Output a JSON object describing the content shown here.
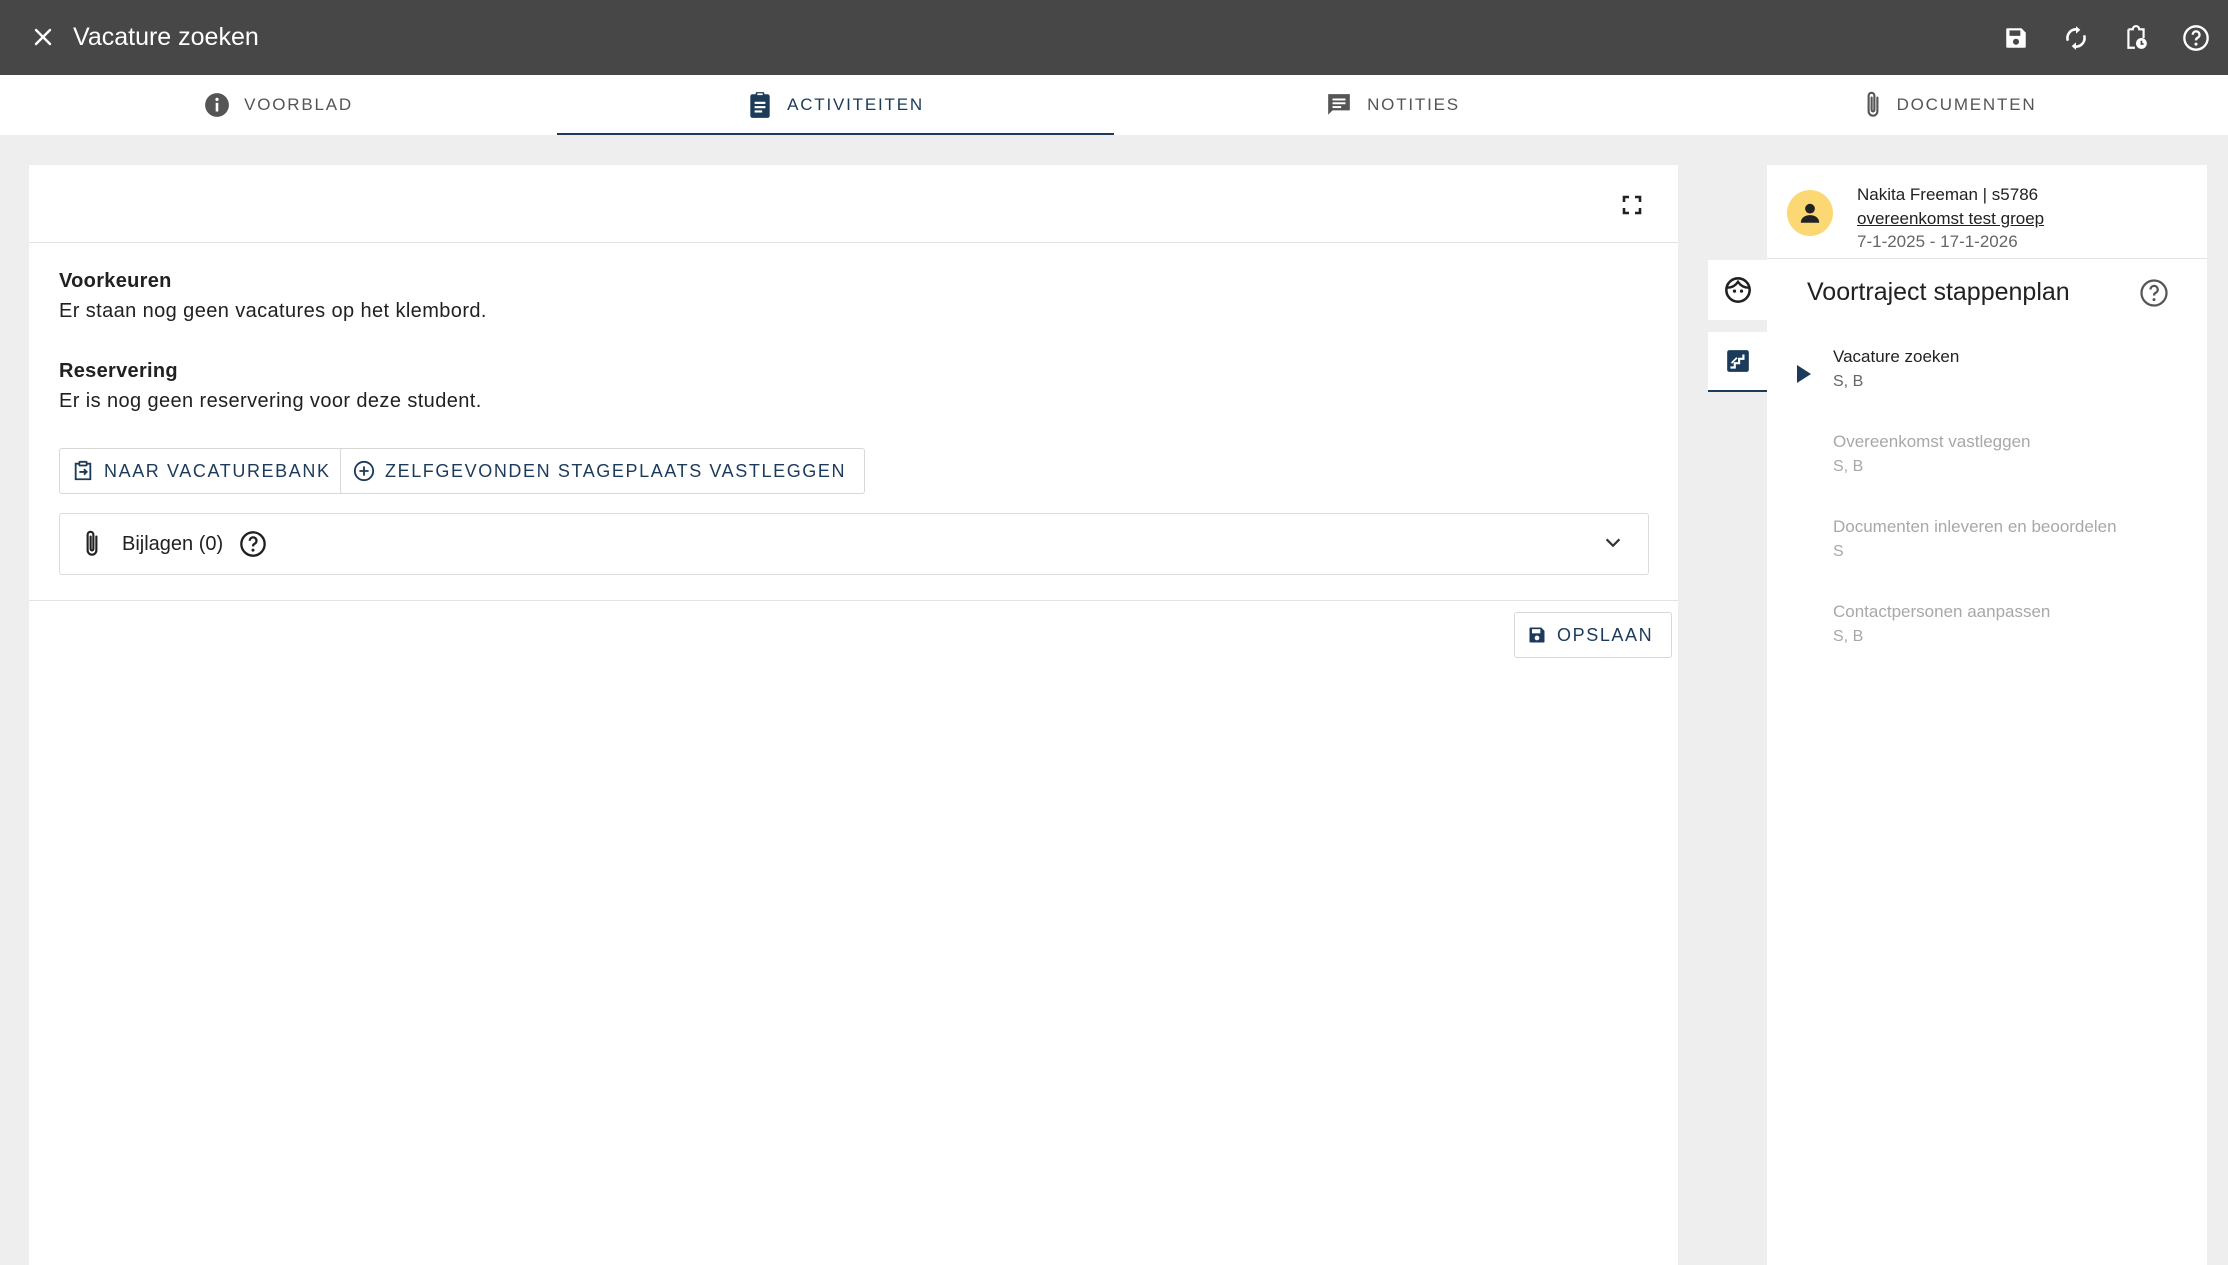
{
  "topbar": {
    "title": "Vacature zoeken",
    "icons": [
      "close-icon",
      "save-icon",
      "refresh-icon",
      "clipboard-clock-icon",
      "help-icon"
    ]
  },
  "tabs": [
    {
      "label": "VOORBLAD",
      "icon": "info-icon",
      "active": false
    },
    {
      "label": "ACTIVITEITEN",
      "icon": "clipboard-icon",
      "active": true
    },
    {
      "label": "NOTITIES",
      "icon": "notes-icon",
      "active": false
    },
    {
      "label": "DOCUMENTEN",
      "icon": "paperclip-icon",
      "active": false
    }
  ],
  "main": {
    "voorkeuren": {
      "heading": "Voorkeuren",
      "text": "Er staan nog geen vacatures op het klembord."
    },
    "reservering": {
      "heading": "Reservering",
      "text": "Er is nog geen reservering voor deze student."
    },
    "buttons": {
      "vacaturebank": "NAAR VACATUREBANK",
      "stageplaats": "ZELFGEVONDEN STAGEPLAATS VASTLEGGEN",
      "save": "OPSLAAN"
    },
    "attachments": {
      "label": "Bijlagen (0)"
    }
  },
  "panel": {
    "student": {
      "name": "Nakita Freeman | s5786",
      "group": "overeenkomst test groep",
      "dates": "7-1-2025 - 17-1-2026"
    },
    "plan_title": "Voortraject stappenplan",
    "steps": [
      {
        "title": "Vacature zoeken",
        "sub": "S, B",
        "active": true
      },
      {
        "title": "Overeenkomst vastleggen",
        "sub": "S, B",
        "active": false
      },
      {
        "title": "Documenten inleveren en beoordelen",
        "sub": "S",
        "active": false
      },
      {
        "title": "Contactpersonen aanpassen",
        "sub": "S, B",
        "active": false
      }
    ]
  },
  "colors": {
    "topbar": "#474747",
    "accent": "#1c3a5a",
    "avatar": "#fbd873",
    "background": "#eeeeee"
  }
}
